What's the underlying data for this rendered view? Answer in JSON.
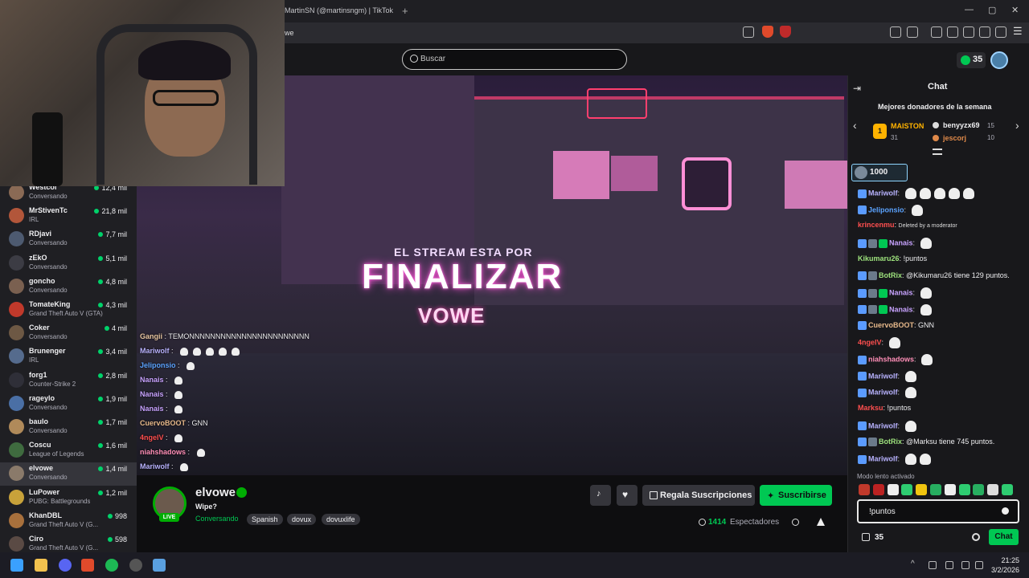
{
  "browser": {
    "tab_title": "MartinSN (@martinsngm) | TikTok",
    "new_tab": "+",
    "address": "we",
    "window_controls": [
      "—",
      "▢",
      "✕"
    ]
  },
  "topbar": {
    "search_placeholder": "Buscar",
    "points": "35"
  },
  "sidebar": {
    "channels": [
      {
        "name": "Westcol",
        "game": "Conversando",
        "viewers": "12,4 mil",
        "color": "#8a6a55"
      },
      {
        "name": "MrStivenTc",
        "game": "IRL",
        "viewers": "21,8 mil",
        "color": "#b2563a"
      },
      {
        "name": "RDjavi",
        "game": "Conversando",
        "viewers": "7,7 mil",
        "color": "#4d5a70"
      },
      {
        "name": "zEkO",
        "game": "Conversando",
        "viewers": "5,1 mil",
        "color": "#3c3c44"
      },
      {
        "name": "goncho",
        "game": "Conversando",
        "viewers": "4,8 mil",
        "color": "#7a6050"
      },
      {
        "name": "TomateKing",
        "game": "Grand Theft Auto V (GTA)",
        "viewers": "4,3 mil",
        "color": "#c0392b"
      },
      {
        "name": "Coker",
        "game": "Conversando",
        "viewers": "4 mil",
        "color": "#6d5844"
      },
      {
        "name": "Brunenger",
        "game": "IRL",
        "viewers": "3,4 mil",
        "color": "#556b8d"
      },
      {
        "name": "forg1",
        "game": "Counter-Strike 2",
        "viewers": "2,8 mil",
        "color": "#2f2f38"
      },
      {
        "name": "rageylo",
        "game": "Conversando",
        "viewers": "1,9 mil",
        "color": "#4a6fa5"
      },
      {
        "name": "baulo",
        "game": "Conversando",
        "viewers": "1,7 mil",
        "color": "#b08a5a"
      },
      {
        "name": "Coscu",
        "game": "League of Legends",
        "viewers": "1,6 mil",
        "color": "#3f6b3f"
      },
      {
        "name": "elvowe",
        "game": "Conversando",
        "viewers": "1,4 mil",
        "color": "#8a7a6a"
      },
      {
        "name": "LuPower",
        "game": "PUBG: Battlegrounds",
        "viewers": "1,2 mil",
        "color": "#c8a23a"
      },
      {
        "name": "KhanDBL",
        "game": "Grand Theft Auto V (G...",
        "viewers": "998",
        "color": "#a8703c"
      },
      {
        "name": "Ciro",
        "game": "Grand Theft Auto V (G...",
        "viewers": "598",
        "color": "#5a4a44"
      }
    ]
  },
  "video": {
    "subtitle": "EL STREAM ESTA POR",
    "title": "FINALIZAR",
    "logo": "VOWE",
    "overlay_chat": [
      {
        "user": "Gangii",
        "user_color": "#e8c6a0",
        "text": "TEMONNNNNNNNNNNNNNNNNNNNNNN",
        "emotes": 0
      },
      {
        "user": "Mariwolf",
        "user_color": "#b9b3ff",
        "text": "",
        "emotes": 5
      },
      {
        "user": "Jeliponsio",
        "user_color": "#5ba3ff",
        "text": "",
        "emotes": 1
      },
      {
        "user": "Nanais",
        "user_color": "#c8a3ff",
        "text": "",
        "emotes": 1
      },
      {
        "user": "Nanais",
        "user_color": "#c8a3ff",
        "text": "",
        "emotes": 1
      },
      {
        "user": "Nanais",
        "user_color": "#c8a3ff",
        "text": "",
        "emotes": 1
      },
      {
        "user": "CuervoBOOT",
        "user_color": "#e6b88a",
        "text": "GNN",
        "emotes": 0
      },
      {
        "user": "4ngelV",
        "user_color": "#ff4f4f",
        "text": "",
        "emotes": 1
      },
      {
        "user": "niahshadows",
        "user_color": "#ff8fb8",
        "text": "",
        "emotes": 1
      },
      {
        "user": "Mariwolf",
        "user_color": "#b9b3ff",
        "text": "",
        "emotes": 1
      }
    ]
  },
  "stream": {
    "name": "elvowe",
    "title": "Wipe?",
    "category": "Conversando",
    "live": "LIVE",
    "tags": [
      "Spanish",
      "dovux",
      "dovuxlife"
    ],
    "gift_label": "Regala Suscripciones",
    "subscribe_label": "Suscribirse",
    "viewers": "1414",
    "viewers_label": "Espectadores"
  },
  "chat": {
    "title": "Chat",
    "donors_title": "Mejores donadores de la semana",
    "donors": [
      {
        "rank": "1",
        "name": "MAISTON",
        "points": "31"
      },
      {
        "name": "benyyzx69",
        "points": "15"
      },
      {
        "name": "jescorj",
        "points": "10"
      }
    ],
    "pinned": "1000",
    "messages": [
      {
        "user": "Mariwolf",
        "color": "#b9b3ff",
        "sep": ":",
        "text": "",
        "emotes": 5,
        "badges": 1
      },
      {
        "user": "Jeliponsio",
        "color": "#5ba3ff",
        "sep": ":",
        "text": "",
        "emotes": 1,
        "badges": 1
      },
      {
        "user": "krincenmu",
        "color": "#ff4f4f",
        "sep": ":",
        "text": "Deleted by a moderator",
        "emotes": 0,
        "badges": 0
      },
      {
        "user": "Nanais",
        "color": "#c8a3ff",
        "sep": ":",
        "text": "",
        "emotes": 1,
        "badges": 3
      },
      {
        "user": "Kikumaru26",
        "color": "#9ee37d",
        "sep": ":",
        "text": "!puntos",
        "emotes": 0,
        "badges": 0
      },
      {
        "user": "BotRix",
        "color": "#9ee37d",
        "sep": ":",
        "text": "@Kikumaru26 tiene 129 puntos.",
        "emotes": 0,
        "badges": 2
      },
      {
        "user": "Nanais",
        "color": "#c8a3ff",
        "sep": ":",
        "text": "",
        "emotes": 1,
        "badges": 3
      },
      {
        "user": "Nanais",
        "color": "#c8a3ff",
        "sep": ":",
        "text": "",
        "emotes": 1,
        "badges": 3
      },
      {
        "user": "CuervoBOOT",
        "color": "#e6b88a",
        "sep": ":",
        "text": "GNN",
        "emotes": 0,
        "badges": 1
      },
      {
        "user": "4ngelV",
        "color": "#ff4f4f",
        "sep": ":",
        "text": "",
        "emotes": 1,
        "badges": 0
      },
      {
        "user": "niahshadows",
        "color": "#ff8fb8",
        "sep": ":",
        "text": "",
        "emotes": 1,
        "badges": 1
      },
      {
        "user": "Mariwolf",
        "color": "#b9b3ff",
        "sep": ":",
        "text": "",
        "emotes": 1,
        "badges": 1
      },
      {
        "user": "Mariwolf",
        "color": "#b9b3ff",
        "sep": ":",
        "text": "",
        "emotes": 1,
        "badges": 1
      },
      {
        "user": "Marksu",
        "color": "#ff4f4f",
        "sep": ":",
        "text": "!puntos",
        "emotes": 0,
        "badges": 0
      },
      {
        "user": "Mariwolf",
        "color": "#b9b3ff",
        "sep": ":",
        "text": "",
        "emotes": 1,
        "badges": 1
      },
      {
        "user": "BotRix",
        "color": "#9ee37d",
        "sep": ":",
        "text": "@Marksu tiene 745 puntos.",
        "emotes": 0,
        "badges": 2
      },
      {
        "user": "Mariwolf",
        "color": "#b9b3ff",
        "sep": ":",
        "text": "",
        "emotes": 2,
        "badges": 1
      }
    ],
    "slow_mode": "Modo lento activado",
    "input_value": "!puntos",
    "points": "35",
    "send_label": "Chat"
  },
  "taskbar": {
    "time": "21:25",
    "date": "3/2/2026"
  }
}
